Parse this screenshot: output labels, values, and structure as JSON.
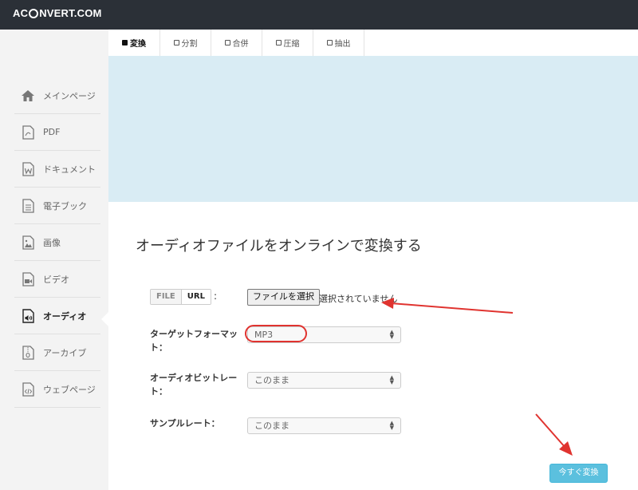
{
  "app": {
    "logo_left": "AC",
    "logo_right": "NVERT.COM"
  },
  "tabs": [
    {
      "label": "変換",
      "active": true
    },
    {
      "label": "分割",
      "active": false
    },
    {
      "label": "合併",
      "active": false
    },
    {
      "label": "圧縮",
      "active": false
    },
    {
      "label": "抽出",
      "active": false
    }
  ],
  "sidebar": {
    "items": [
      {
        "label": "メインページ",
        "icon": "home-icon"
      },
      {
        "label": "PDF",
        "icon": "pdf-file-icon"
      },
      {
        "label": "ドキュメント",
        "icon": "word-document-icon"
      },
      {
        "label": "電子ブック",
        "icon": "ebook-file-icon"
      },
      {
        "label": "画像",
        "icon": "image-file-icon"
      },
      {
        "label": "ビデオ",
        "icon": "video-file-icon"
      },
      {
        "label": "オーディオ",
        "icon": "audio-file-icon",
        "active": true
      },
      {
        "label": "アーカイブ",
        "icon": "archive-file-icon"
      },
      {
        "label": "ウェブページ",
        "icon": "webpage-file-icon"
      }
    ]
  },
  "main": {
    "title": "オーディオファイルをオンラインで変換する",
    "source_toggle": {
      "file": "FILE",
      "url": "URL",
      "colon": ":"
    },
    "file_input": {
      "button": "ファイルを選択",
      "status": "選択されていません"
    },
    "target_format": {
      "label": "ターゲットフォーマット：",
      "value": "MP3"
    },
    "audio_bitrate": {
      "label": "オーディオビットレート：",
      "value": "このまま"
    },
    "sample_rate": {
      "label": "サンプルレート：",
      "value": "このまま"
    },
    "convert_button": "今すぐ変換"
  },
  "colors": {
    "topbar": "#2b3037",
    "banner": "#d9ecf4",
    "sidebar": "#f3f3f3",
    "annotation": "#e0332f",
    "convert_button": "#5bc0de"
  }
}
